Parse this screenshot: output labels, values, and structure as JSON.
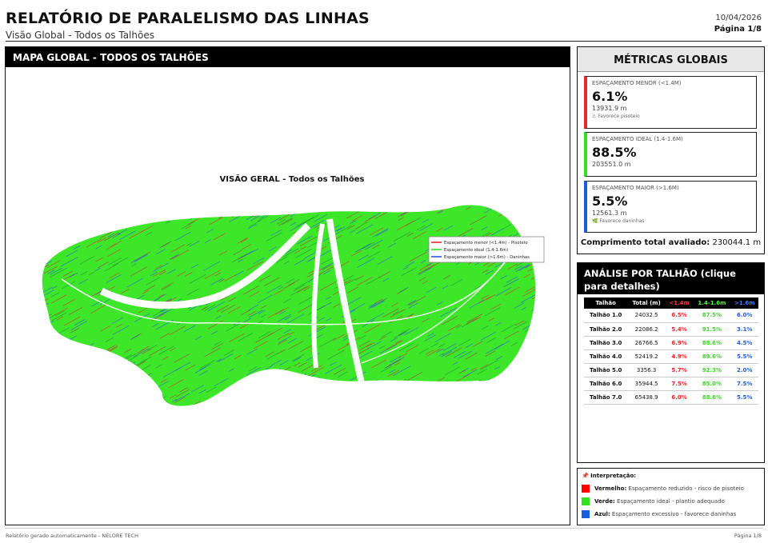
{
  "header": {
    "title": "RELATÓRIO DE PARALELISMO DAS LINHAS",
    "subtitle": "Visão Global - Todos os Talhões",
    "date": "10/04/2026",
    "page": "Página 1/8"
  },
  "map": {
    "panel_title": "MAPA GLOBAL - TODOS OS TALHÕES",
    "plot_title": "VISÃO GERAL - Todos os Talhões",
    "legend": [
      {
        "label": "Espaçamento menor (<1.4m) - Pisoteio",
        "color": "#e8262a"
      },
      {
        "label": "Espaçamento ideal (1.4-1.6m)",
        "color": "#33e01c"
      },
      {
        "label": "Espaçamento maior (>1.6m) - Daninhas",
        "color": "#2a55e8"
      }
    ]
  },
  "metrics": {
    "title": "MÉTRICAS GLOBAIS",
    "cards": [
      {
        "label": "ESPAÇAMENTO MENOR (<1.4M)",
        "percent": "6.1%",
        "length": "13931.9 m",
        "note": "⚠ Favorece pisoteio",
        "color": "#e8262a"
      },
      {
        "label": "ESPAÇAMENTO IDEAL (1.4-1.6M)",
        "percent": "88.5%",
        "length": "203551.0 m",
        "note": "",
        "color": "#33e01c"
      },
      {
        "label": "ESPAÇAMENTO MAIOR (>1.6M)",
        "percent": "5.5%",
        "length": "12561.3 m",
        "note": "🌿 Favorece daninhas",
        "color": "#1a5ee0"
      }
    ],
    "total_label": "Comprimento total avaliado:",
    "total_value": "230044.1 m"
  },
  "analysis": {
    "title": "ANÁLISE POR TALHÃO (clique para detalhes)",
    "columns": [
      "Talhão",
      "Total (m)",
      "<1.4m",
      "1.4-1.6m",
      ">1.6m"
    ],
    "rows": [
      {
        "name": "Talhão 1.0",
        "total": "24032.5",
        "low": "6.5%",
        "ideal": "87.5%",
        "high": "6.0%"
      },
      {
        "name": "Talhão 2.0",
        "total": "22086.2",
        "low": "5.4%",
        "ideal": "91.5%",
        "high": "3.1%"
      },
      {
        "name": "Talhão 3.0",
        "total": "26766.5",
        "low": "6.9%",
        "ideal": "88.6%",
        "high": "4.5%"
      },
      {
        "name": "Talhão 4.0",
        "total": "52419.2",
        "low": "4.9%",
        "ideal": "89.6%",
        "high": "5.5%"
      },
      {
        "name": "Talhão 5.0",
        "total": "3356.3",
        "low": "5.7%",
        "ideal": "92.3%",
        "high": "2.0%"
      },
      {
        "name": "Talhão 6.0",
        "total": "35944.5",
        "low": "7.5%",
        "ideal": "85.0%",
        "high": "7.5%"
      },
      {
        "name": "Talhão 7.0",
        "total": "65438.9",
        "low": "6.0%",
        "ideal": "88.6%",
        "high": "5.5%"
      }
    ],
    "colors": {
      "low": "#e8262a",
      "ideal": "#33e01c",
      "high": "#1a5ee0"
    }
  },
  "interpretation": {
    "title": "📌 Interpretação:",
    "items": [
      {
        "key": "Vermelho:",
        "text": "Espaçamento reduzido - risco de pisoteio",
        "color": "#ff0000"
      },
      {
        "key": "Verde:",
        "text": "Espaçamento ideal - plantio adequado",
        "color": "#33e01c"
      },
      {
        "key": "Azul:",
        "text": "Espaçamento excessivo - favorece daninhas",
        "color": "#1a5ee0"
      }
    ]
  },
  "footer": {
    "left": "Relatório gerado automaticamente - NELORE TECH",
    "right": "Página 1/8"
  }
}
